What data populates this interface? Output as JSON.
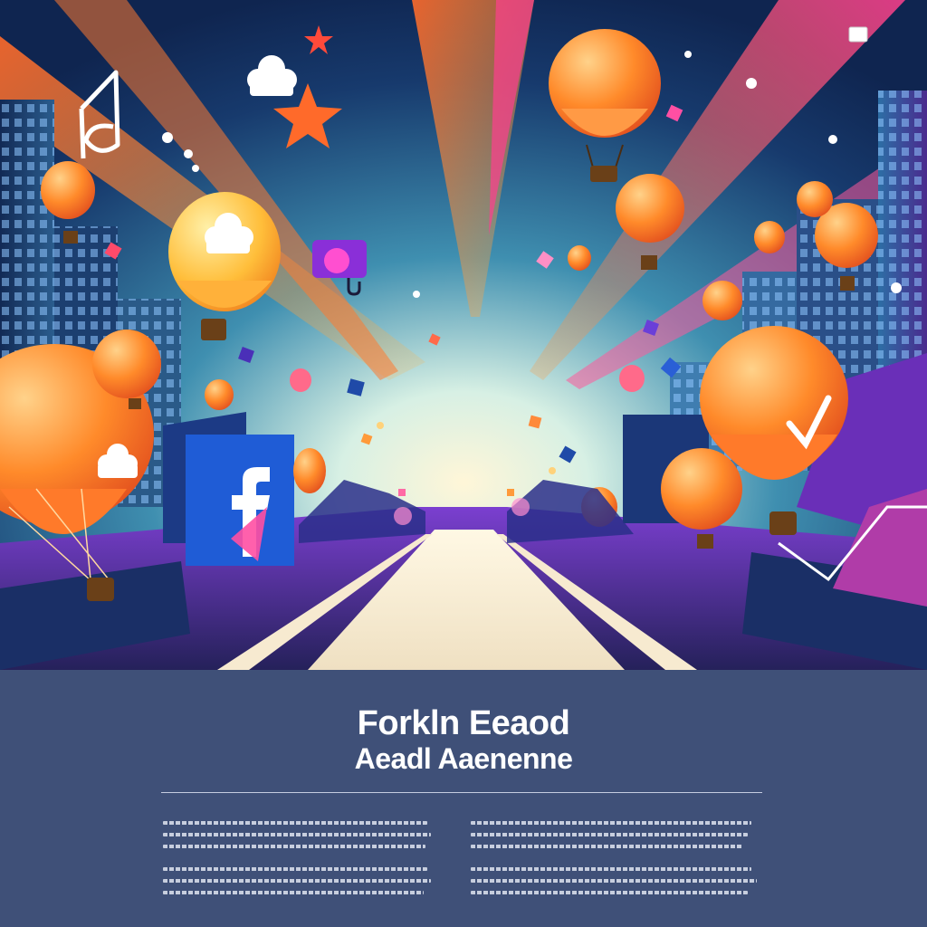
{
  "poster": {
    "title_line_1": "Forkln Eeaod",
    "title_line_2": "Aeadl Aaenenne"
  },
  "illustration": {
    "subject": "hot-air-balloons-over-city-street",
    "icons": [
      "facebook-f-icon",
      "star-icon",
      "checkmark-icon",
      "cloud-icon",
      "lock-icon"
    ]
  },
  "colors": {
    "footer_background": "#3f5078",
    "sky_top": "#102a55",
    "sky_glow": "#fff6d8",
    "balloon_orange": "#ff8a2a",
    "facebook_blue": "#1f5cd6",
    "accent_pink": "#ff4fa3"
  }
}
